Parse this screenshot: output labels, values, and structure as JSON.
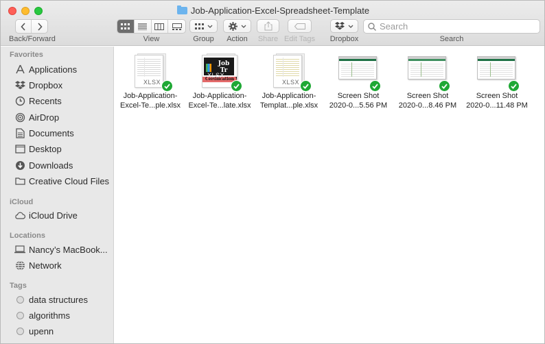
{
  "window": {
    "title": "Job-Application-Excel-Spreadsheet-Template"
  },
  "toolbar": {
    "back_forward_label": "Back/Forward",
    "view_label": "View",
    "group_label": "Group",
    "action_label": "Action",
    "share_label": "Share",
    "edit_tags_label": "Edit Tags",
    "dropbox_label": "Dropbox",
    "search_label": "Search",
    "search_placeholder": "Search",
    "active_view": "icons"
  },
  "sidebar": {
    "favorites_title": "Favorites",
    "favorites": [
      {
        "label": "Applications",
        "icon": "applications-icon"
      },
      {
        "label": "Dropbox",
        "icon": "dropbox-icon"
      },
      {
        "label": "Recents",
        "icon": "clock-icon"
      },
      {
        "label": "AirDrop",
        "icon": "airdrop-icon"
      },
      {
        "label": "Documents",
        "icon": "document-icon"
      },
      {
        "label": "Desktop",
        "icon": "desktop-icon"
      },
      {
        "label": "Downloads",
        "icon": "download-icon"
      },
      {
        "label": "Creative Cloud Files",
        "icon": "folder-icon"
      }
    ],
    "icloud_title": "iCloud",
    "icloud": [
      {
        "label": "iCloud Drive",
        "icon": "cloud-icon"
      }
    ],
    "locations_title": "Locations",
    "locations": [
      {
        "label": "Nancy’s MacBook...",
        "icon": "laptop-icon"
      },
      {
        "label": "Network",
        "icon": "globe-icon"
      }
    ],
    "tags_title": "Tags",
    "tags": [
      {
        "label": "data structures"
      },
      {
        "label": "algorithms"
      },
      {
        "label": "upenn"
      }
    ]
  },
  "files": [
    {
      "line1": "Job-Application-",
      "line2": "Excel-Te...ple.xlsx",
      "type": "xlsx",
      "badge": "XLSX",
      "synced": true
    },
    {
      "line1": "Job-Application-",
      "line2": "Excel-Te...late.xlsx",
      "type": "xlsx-cert",
      "badge": "XLSX",
      "synced": true
    },
    {
      "line1": "Job-Application-",
      "line2": "Templat...ple.xlsx",
      "type": "xlsx",
      "badge": "XLSX",
      "synced": true
    },
    {
      "line1": "Screen Shot",
      "line2": "2020-0...5.56 PM",
      "type": "screenshot",
      "synced": true
    },
    {
      "line1": "Screen Shot",
      "line2": "2020-0...8.46 PM",
      "type": "screenshot",
      "synced": true
    },
    {
      "line1": "Screen Shot",
      "line2": "2020-0...11.48 PM",
      "type": "screenshot",
      "synced": true
    }
  ],
  "thumbnail_text": {
    "cert_title": "Job Tr",
    "cert_band": "Certification W"
  },
  "colors": {
    "sync_check": "#1fa835",
    "folder": "#6cb4ee"
  }
}
